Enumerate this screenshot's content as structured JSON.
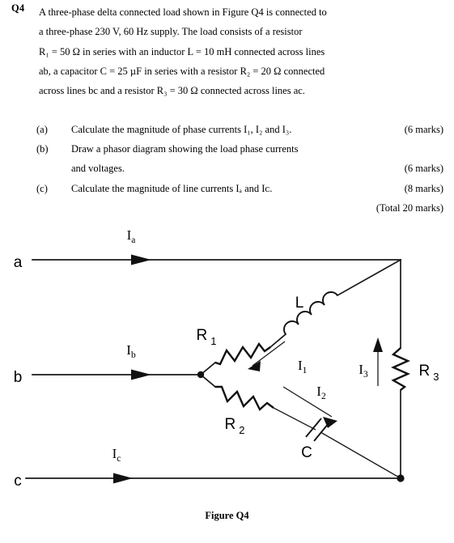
{
  "question": {
    "number": "Q4",
    "stem_lines": [
      "A three-phase delta connected load shown in Figure Q4 is connected to",
      "a three-phase 230 V, 60 Hz supply. The load consists of a resistor",
      "R₁ = 50 Ω in series with an inductor L = 10 mH connected across lines",
      "ab, a capacitor C = 25 µF in series with a resistor R₂ = 20 Ω connected",
      "across lines bc and a resistor R₃ = 30 Ω connected across lines ac."
    ],
    "parts": [
      {
        "label": "(a)",
        "text": "Calculate the magnitude of phase currents I₁, I₂ and I₃.",
        "marks": "(6 marks)"
      },
      {
        "label": "(b)",
        "text": "Draw a phasor diagram showing the load phase currents",
        "marks": ""
      },
      {
        "label": "",
        "text": "and voltages.",
        "marks": "(6 marks)"
      },
      {
        "label": "(c)",
        "text": "Calculate the magnitude of line currents Iₐ and Iᴄ.",
        "marks": "(8 marks)"
      }
    ],
    "total_marks": "(Total 20 marks)"
  },
  "figure": {
    "caption": "Figure Q4",
    "node_labels": {
      "a": "a",
      "b": "b",
      "c": "c"
    },
    "line_current_labels": {
      "ia": {
        "base": "I",
        "sub": "a"
      },
      "ib": {
        "base": "I",
        "sub": "b"
      },
      "ic": {
        "base": "I",
        "sub": "c"
      }
    },
    "phase_current_labels": {
      "i1": {
        "base": "I",
        "sub": "1"
      },
      "i2": {
        "base": "I",
        "sub": "2"
      },
      "i3": {
        "base": "I",
        "sub": "3"
      }
    },
    "component_labels": {
      "r1": {
        "base": "R",
        "sub": "1"
      },
      "r2": {
        "base": "R",
        "sub": "2"
      },
      "r3": {
        "base": "R",
        "sub": "3"
      },
      "l": "L",
      "c": "C"
    }
  },
  "values": {
    "supply_voltage": "230 V",
    "supply_frequency": "60 Hz",
    "r1": "50 Ω",
    "r2": "20 Ω",
    "r3": "30 Ω",
    "l": "10 mH",
    "c": "25 µF"
  },
  "colors": {
    "ink": "#000000",
    "wire": "#1a1a1a",
    "page": "#ffffff"
  }
}
